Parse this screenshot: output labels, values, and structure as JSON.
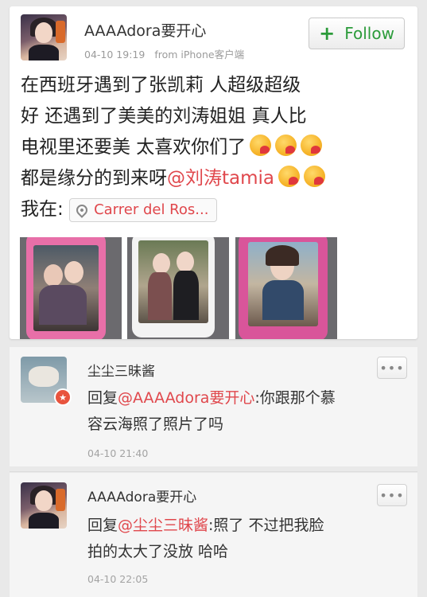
{
  "post": {
    "author": "AAAAdora要开心",
    "date": "04-10 19:19",
    "source": "from iPhone客户端",
    "follow_label": "Follow",
    "text_line1": "在西班牙遇到了张凯莉 人超级超级",
    "text_line2": "好 还遇到了美美的刘涛姐姐 真人比",
    "text_line3": "电视里还要美 太喜欢你们了",
    "text_line4_prefix": "都是缘分的到来呀",
    "mention": "@刘涛tamia",
    "location_prefix": "我在:",
    "location": "Carrer del Ros..."
  },
  "comments": [
    {
      "author": "尘尘三昧酱",
      "reply_prefix": "回复",
      "mention": "@AAAAdora要开心",
      "text_part1": ":你跟那个慕",
      "text_part2": "容云海照了照片了吗",
      "time": "04-10 21:40",
      "more_label": "•••"
    },
    {
      "author": "AAAAdora要开心",
      "reply_prefix": "回复",
      "mention": "@尘尘三昧酱",
      "text_part1": ":照了 不过把我脸",
      "text_part2": "拍的太大了没放 哈哈",
      "time": "04-10 22:05",
      "more_label": "•••"
    }
  ],
  "colors": {
    "mention": "#e0474c",
    "follow": "#2b9b3a",
    "verified_badge": "#e8543e"
  },
  "icons": [
    "plus-icon",
    "emoji-icon",
    "location-pin-icon",
    "more-icon",
    "verified-badge-icon"
  ]
}
